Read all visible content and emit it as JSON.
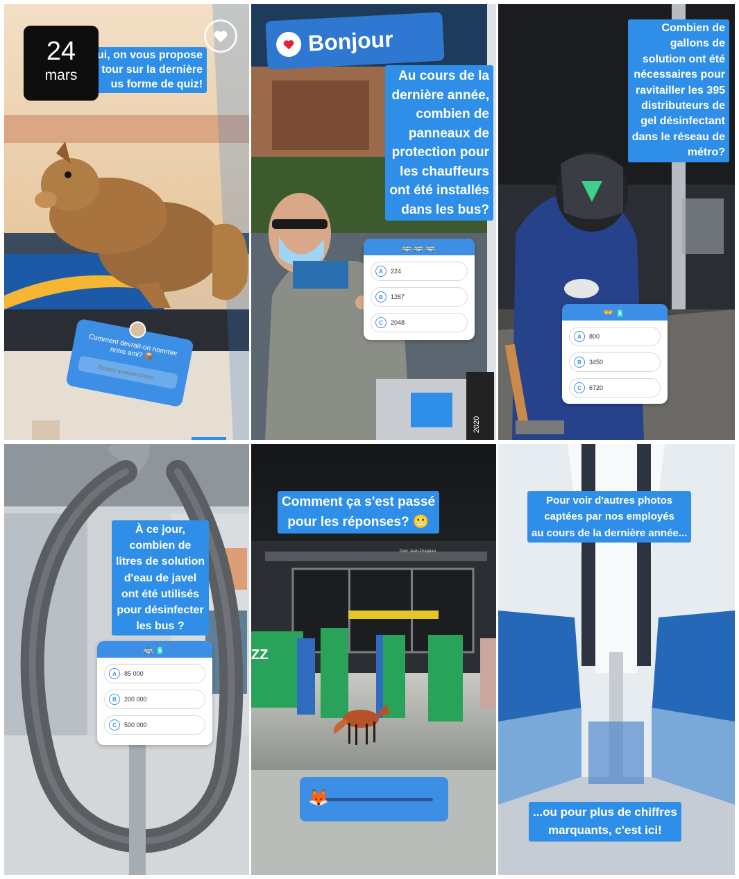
{
  "date_badge": {
    "day": "24",
    "month": "mars"
  },
  "panel1": {
    "caption_lines": [
      "ui, on vous propose",
      "tour sur la dernière",
      "us forme de quiz!"
    ],
    "question_sticker": {
      "text": "Comment devrait-on nommer notre ami? 📦",
      "placeholder": "Écrivez quelque chose..."
    }
  },
  "panel2": {
    "sign": "Bonjour",
    "caption_lines": [
      "Au cours de la",
      "dernière année,",
      "combien de",
      "panneaux de",
      "protection pour",
      "les chauffeurs",
      "ont été installés",
      "dans les bus?"
    ],
    "quiz": {
      "header_emoji": "🚌🚌🚌",
      "options": [
        {
          "letter": "A",
          "text": "224"
        },
        {
          "letter": "B",
          "text": "1267"
        },
        {
          "letter": "C",
          "text": "2048"
        }
      ]
    },
    "bus_year": "2020"
  },
  "panel3": {
    "caption_lines": [
      "Combien de",
      "gallons de",
      "solution ont été",
      "nécessaires pour",
      "ravitailler les 395",
      "distributeurs de",
      "gel désinfectant",
      "dans le réseau de",
      "métro?"
    ],
    "quiz": {
      "header_emoji": "👐🧴",
      "options": [
        {
          "letter": "A",
          "text": "800"
        },
        {
          "letter": "B",
          "text": "3450"
        },
        {
          "letter": "C",
          "text": "6720"
        }
      ]
    }
  },
  "panel4": {
    "caption_lines": [
      "À ce jour,",
      "combien de",
      "litres de solution",
      "d'eau de javel",
      "ont été utilisés",
      "pour désinfecter",
      "les bus ?"
    ],
    "quiz": {
      "header_emoji": "🚌🧴",
      "options": [
        {
          "letter": "A",
          "text": "85 000"
        },
        {
          "letter": "B",
          "text": "200 000"
        },
        {
          "letter": "C",
          "text": "500 000"
        }
      ]
    }
  },
  "panel5": {
    "caption_lines": [
      "Comment ça s'est passé",
      "pour les réponses? 😬"
    ],
    "station_sign": "Parc Jean-Drapeau",
    "slider": {
      "emoji": "🦊",
      "value_fraction": 0.0
    }
  },
  "panel6": {
    "caption_top_lines": [
      "Pour voir d'autres photos",
      "captées par nos employés",
      "au cours de la dernière année..."
    ],
    "caption_bottom_lines": [
      "...ou pour plus de chiffres",
      "marquants, c'est ici!"
    ]
  },
  "colors": {
    "caption_blue": "#2f8fe8",
    "quiz_blue": "#3d8fe6"
  }
}
